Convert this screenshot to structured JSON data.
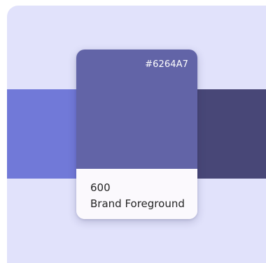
{
  "swatch": {
    "hex": "#6264A7",
    "shade": "600",
    "role": "Brand Foreground"
  },
  "colors": {
    "background_panel": "#e1e2fb",
    "left_neighbor": "#7179d8",
    "swatch_color": "#6264a7",
    "right_neighbor": "#484777",
    "card_footer": "#fbf9fd"
  }
}
